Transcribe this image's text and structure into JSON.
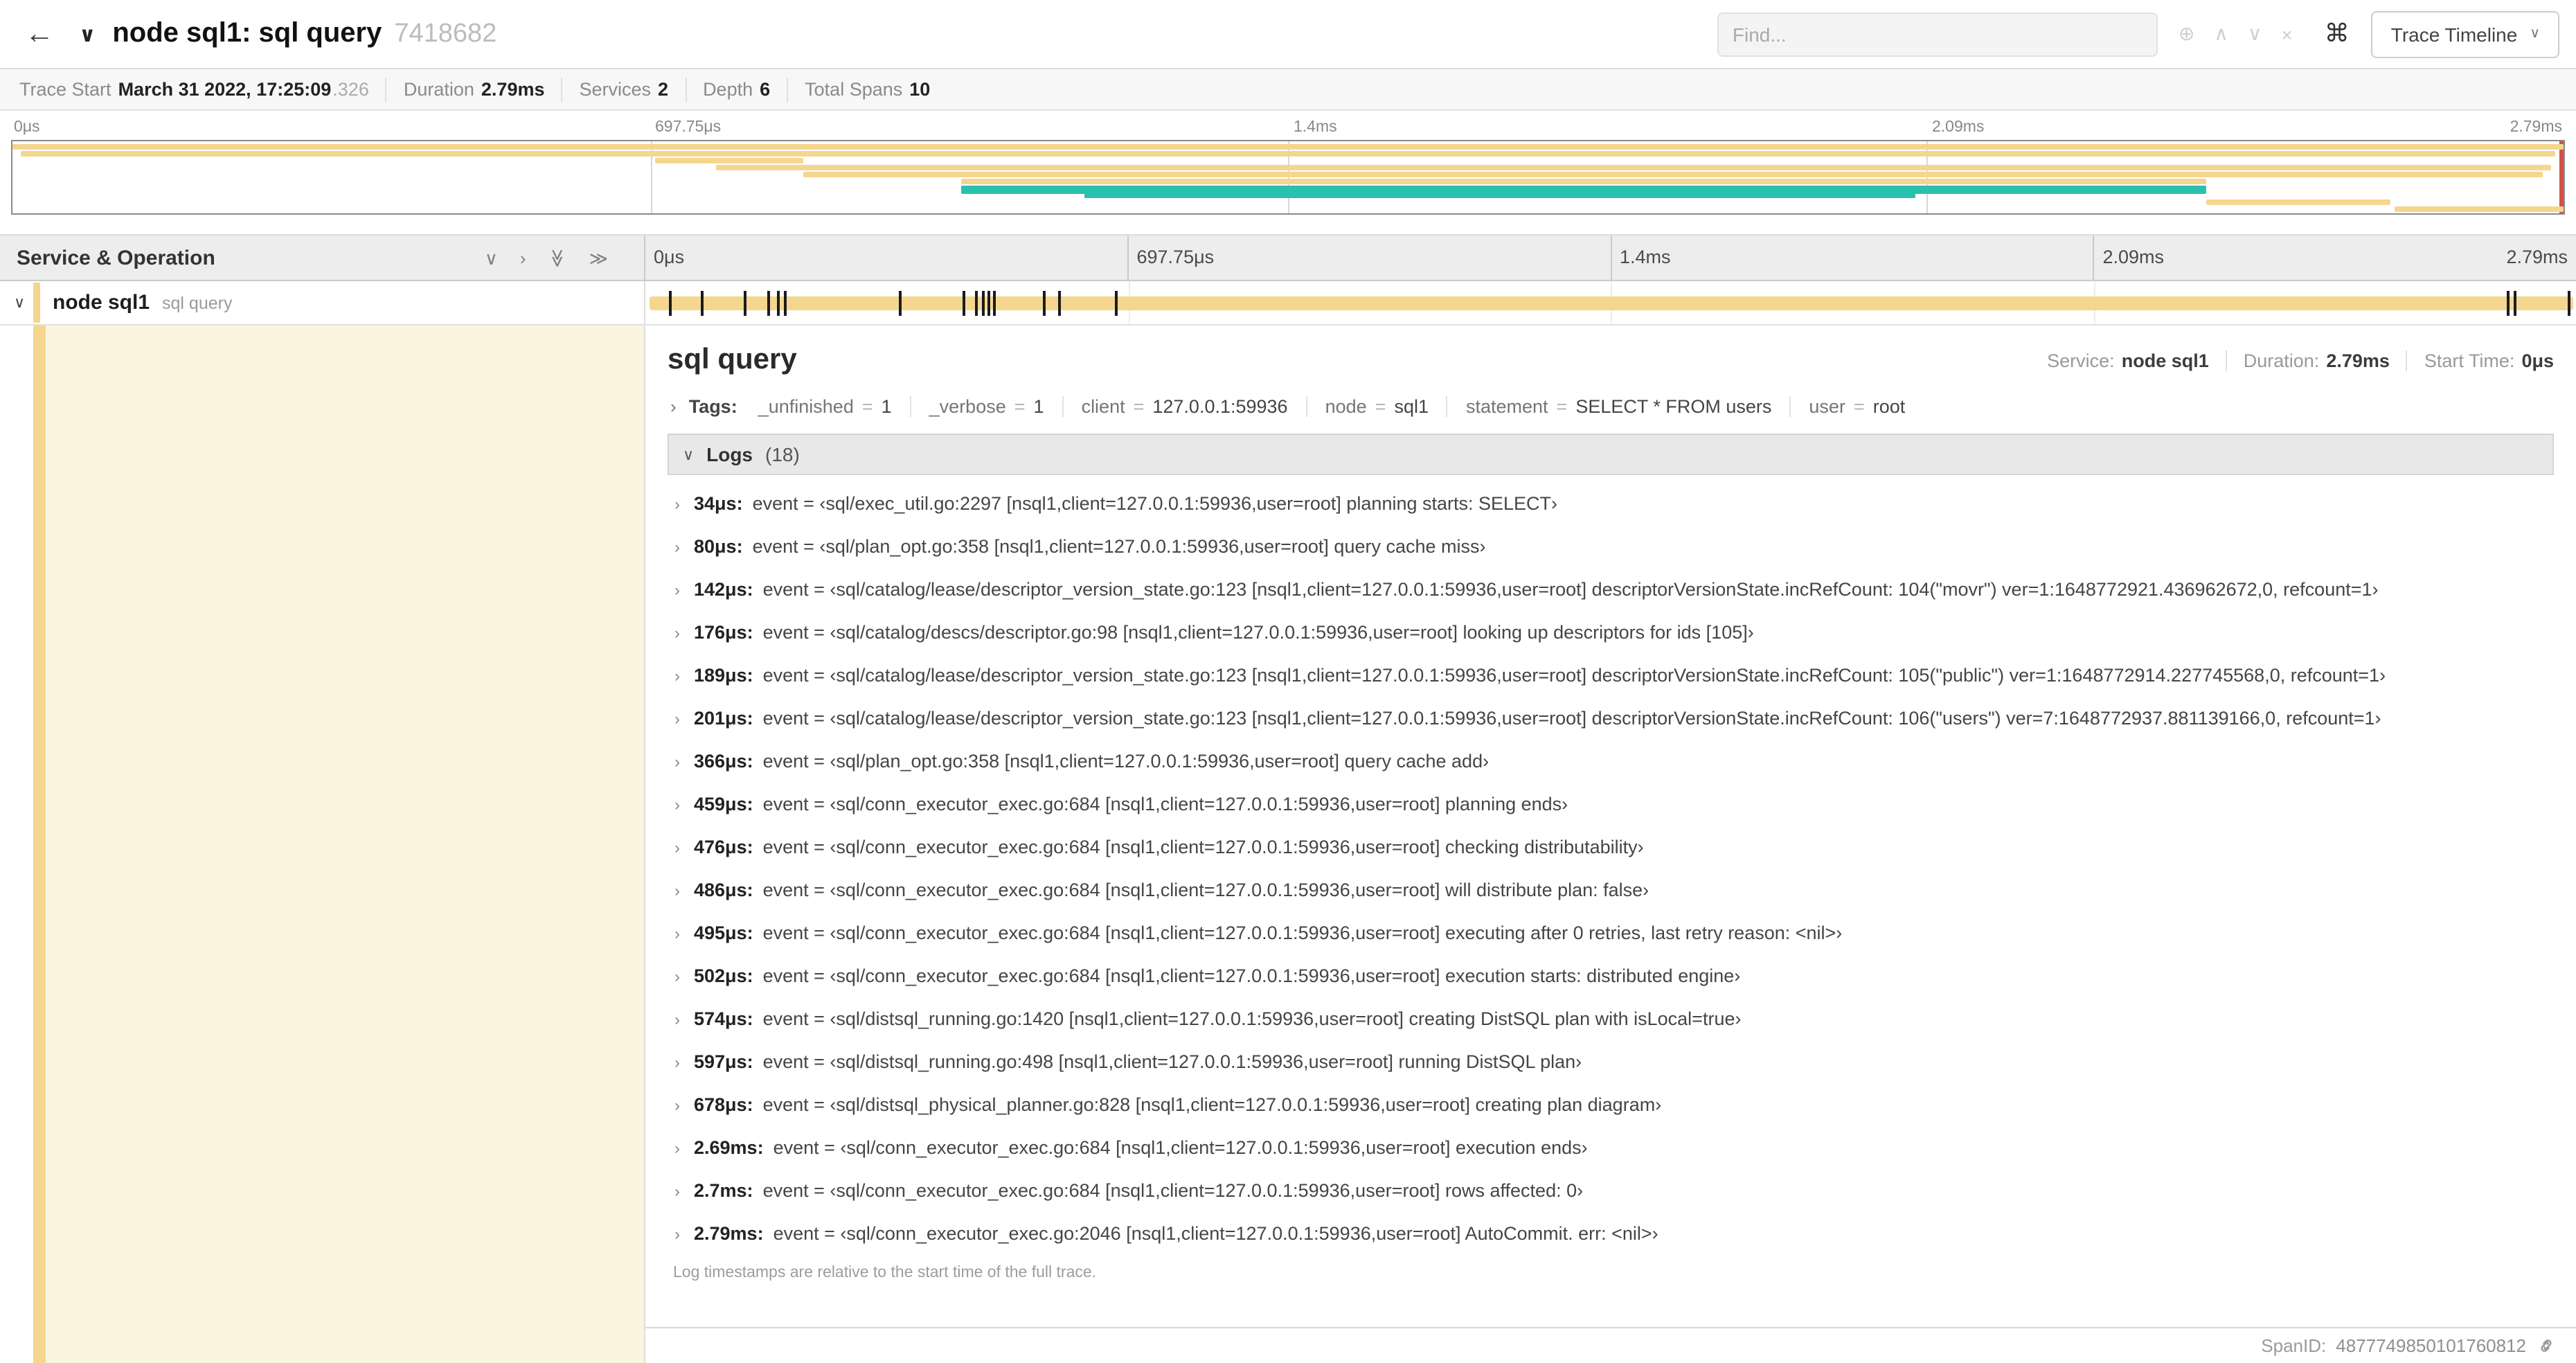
{
  "colors": {
    "tan": "#f5d68f",
    "teal": "#2bc0ae",
    "cream": "#fbf4df",
    "cursor_red": "#d0504a"
  },
  "icons": {
    "back": "←",
    "title_chevron": "∨",
    "command": "⌘",
    "caret_down": "∨",
    "chevron_right": "›",
    "chevron_down_small": "∨"
  },
  "header": {
    "title": "node sql1: sql query",
    "trace_id": "7418682",
    "find_placeholder": "Find...",
    "view_label": "Trace Timeline",
    "find_controls": [
      {
        "name": "find-locate-icon",
        "glyph": "⊕"
      },
      {
        "name": "find-prev-icon",
        "glyph": "∧"
      },
      {
        "name": "find-next-icon",
        "glyph": "∨"
      },
      {
        "name": "find-clear-icon",
        "glyph": "×"
      }
    ]
  },
  "summary": {
    "items": [
      {
        "label": "Trace Start",
        "value": "March 31 2022, 17:25:09",
        "suffix": ".326"
      },
      {
        "label": "Duration",
        "value": "2.79ms"
      },
      {
        "label": "Services",
        "value": "2"
      },
      {
        "label": "Depth",
        "value": "6"
      },
      {
        "label": "Total Spans",
        "value": "10"
      }
    ]
  },
  "minimap": {
    "ticks": [
      "0μs",
      "697.75μs",
      "1.4ms",
      "2.09ms",
      "2.79ms"
    ],
    "tick_positions": [
      0,
      25,
      50,
      75,
      100
    ],
    "gridlines": [
      25,
      50,
      75
    ],
    "spans": [
      {
        "row": 0,
        "start": 0,
        "end": 100,
        "color": "tan"
      },
      {
        "row": 1,
        "start": 0.3,
        "end": 99.7,
        "color": "tan"
      },
      {
        "row": 2,
        "start": 25.2,
        "end": 31.0,
        "color": "tan"
      },
      {
        "row": 3,
        "start": 27.6,
        "end": 99.5,
        "color": "tan"
      },
      {
        "row": 4,
        "start": 31.0,
        "end": 99.2,
        "color": "tan"
      },
      {
        "row": 5,
        "start": 37.2,
        "end": 86.0,
        "color": "tan"
      },
      {
        "row": 6,
        "start": 37.2,
        "end": 86.0,
        "color": "teal",
        "h": 6
      },
      {
        "row": 7,
        "start": 42.0,
        "end": 74.6,
        "color": "teal"
      },
      {
        "row": 8,
        "start": 86.0,
        "end": 93.2,
        "color": "tan"
      },
      {
        "row": 9,
        "start": 93.4,
        "end": 100,
        "color": "tan"
      }
    ]
  },
  "timeline": {
    "left_title": "Service & Operation",
    "ticks": [
      "0μs",
      "697.75μs",
      "1.4ms",
      "2.09ms",
      "2.79ms"
    ],
    "controls": [
      {
        "name": "collapse-one-icon",
        "glyph": "∨"
      },
      {
        "name": "expand-one-icon",
        "glyph": "›"
      },
      {
        "name": "collapse-all-icon",
        "glyph": "≫",
        "rot": true
      },
      {
        "name": "expand-all-icon",
        "glyph": "≫"
      }
    ]
  },
  "span_row": {
    "service": "node sql1",
    "operation": "sql query",
    "log_ticks": [
      1.2,
      2.9,
      5.1,
      6.3,
      6.8,
      7.2,
      13.1,
      16.4,
      17.1,
      17.4,
      17.7,
      18.0,
      20.6,
      21.4,
      24.3,
      96.4,
      96.8,
      99.6
    ]
  },
  "detail": {
    "title": "sql query",
    "meta": [
      {
        "label": "Service:",
        "value": "node sql1"
      },
      {
        "label": "Duration:",
        "value": "2.79ms"
      },
      {
        "label": "Start Time:",
        "value": "0μs"
      }
    ],
    "tags_label": "Tags:",
    "tag_equals": "=",
    "tags": [
      {
        "key": "_unfinished",
        "value": "1"
      },
      {
        "key": "_verbose",
        "value": "1"
      },
      {
        "key": "client",
        "value": "127.0.0.1:59936"
      },
      {
        "key": "node",
        "value": "sql1"
      },
      {
        "key": "statement",
        "value": "SELECT * FROM users"
      },
      {
        "key": "user",
        "value": "root"
      }
    ],
    "logs_label": "Logs",
    "logs_count": "(18)",
    "logs": [
      {
        "time": "34μs:",
        "text": "event = ‹sql/exec_util.go:2297 [nsql1,client=127.0.0.1:59936,user=root] planning starts: SELECT›"
      },
      {
        "time": "80μs:",
        "text": "event = ‹sql/plan_opt.go:358 [nsql1,client=127.0.0.1:59936,user=root] query cache miss›"
      },
      {
        "time": "142μs:",
        "text": "event = ‹sql/catalog/lease/descriptor_version_state.go:123 [nsql1,client=127.0.0.1:59936,user=root] descriptorVersionState.incRefCount: 104(\"movr\") ver=1:1648772921.436962672,0, refcount=1›"
      },
      {
        "time": "176μs:",
        "text": "event = ‹sql/catalog/descs/descriptor.go:98 [nsql1,client=127.0.0.1:59936,user=root] looking up descriptors for ids [105]›"
      },
      {
        "time": "189μs:",
        "text": "event = ‹sql/catalog/lease/descriptor_version_state.go:123 [nsql1,client=127.0.0.1:59936,user=root] descriptorVersionState.incRefCount: 105(\"public\") ver=1:1648772914.227745568,0, refcount=1›"
      },
      {
        "time": "201μs:",
        "text": "event = ‹sql/catalog/lease/descriptor_version_state.go:123 [nsql1,client=127.0.0.1:59936,user=root] descriptorVersionState.incRefCount: 106(\"users\") ver=7:1648772937.881139166,0, refcount=1›"
      },
      {
        "time": "366μs:",
        "text": "event = ‹sql/plan_opt.go:358 [nsql1,client=127.0.0.1:59936,user=root] query cache add›"
      },
      {
        "time": "459μs:",
        "text": "event = ‹sql/conn_executor_exec.go:684 [nsql1,client=127.0.0.1:59936,user=root] planning ends›"
      },
      {
        "time": "476μs:",
        "text": "event = ‹sql/conn_executor_exec.go:684 [nsql1,client=127.0.0.1:59936,user=root] checking distributability›"
      },
      {
        "time": "486μs:",
        "text": "event = ‹sql/conn_executor_exec.go:684 [nsql1,client=127.0.0.1:59936,user=root] will distribute plan: false›"
      },
      {
        "time": "495μs:",
        "text": "event = ‹sql/conn_executor_exec.go:684 [nsql1,client=127.0.0.1:59936,user=root] executing after 0 retries, last retry reason: <nil>›"
      },
      {
        "time": "502μs:",
        "text": "event = ‹sql/conn_executor_exec.go:684 [nsql1,client=127.0.0.1:59936,user=root] execution starts: distributed engine›"
      },
      {
        "time": "574μs:",
        "text": "event = ‹sql/distsql_running.go:1420 [nsql1,client=127.0.0.1:59936,user=root] creating DistSQL plan with isLocal=true›"
      },
      {
        "time": "597μs:",
        "text": "event = ‹sql/distsql_running.go:498 [nsql1,client=127.0.0.1:59936,user=root] running DistSQL plan›"
      },
      {
        "time": "678μs:",
        "text": "event = ‹sql/distsql_physical_planner.go:828 [nsql1,client=127.0.0.1:59936,user=root] creating plan diagram›"
      },
      {
        "time": "2.69ms:",
        "text": "event = ‹sql/conn_executor_exec.go:684 [nsql1,client=127.0.0.1:59936,user=root] execution ends›"
      },
      {
        "time": "2.7ms:",
        "text": "event = ‹sql/conn_executor_exec.go:684 [nsql1,client=127.0.0.1:59936,user=root] rows affected: 0›"
      },
      {
        "time": "2.79ms:",
        "text": "event = ‹sql/conn_executor_exec.go:2046 [nsql1,client=127.0.0.1:59936,user=root] AutoCommit. err: <nil>›"
      }
    ],
    "footnote": "Log timestamps are relative to the start time of the full trace.",
    "span_id_label": "SpanID:",
    "span_id": "4877749850101760812"
  }
}
